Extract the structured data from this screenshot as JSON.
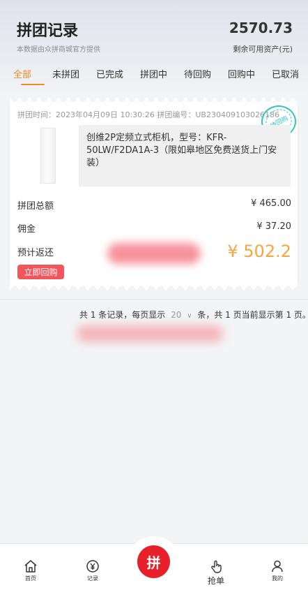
{
  "header": {
    "title": "拼团记录",
    "subtitle": "本数据由众拼商城官方提供",
    "balance_value": "2570.73",
    "balance_label": "剩余可用资产(元)"
  },
  "tabs": [
    {
      "label": "全部",
      "active": true
    },
    {
      "label": "未拼团"
    },
    {
      "label": "已完成"
    },
    {
      "label": "拼团中"
    },
    {
      "label": "待回购"
    },
    {
      "label": "回购中"
    },
    {
      "label": "已取消"
    }
  ],
  "order": {
    "meta": "拼团时间：2023年04月09日 10:30:26 拼团编号：UB230409103026186",
    "stamp_text": "待回购",
    "product_name": "创维2P定频立式柜机，型号：KFR-50LW/F2DA1A-3（限如皋地区免费送货上门安装）",
    "rows": [
      {
        "label": "拼团总额",
        "value": "¥ 465.00"
      },
      {
        "label": "佣金",
        "value": "¥ 37.20"
      }
    ],
    "rebate_label": "预计返还",
    "rebate_value": "¥ 502.2",
    "buyback_button": "立即回购"
  },
  "pager": {
    "prefix": "共 1 条记录，每页显示",
    "page_size": "20",
    "suffix": "条，共 1 页当前显示第 1 页。"
  },
  "tabbar": {
    "items": [
      {
        "label": "首页",
        "icon": "home-icon"
      },
      {
        "label": "记录",
        "icon": "record-icon"
      },
      {
        "label": "拼",
        "icon": "group-buy-icon"
      },
      {
        "label": "抢单",
        "icon": "tap-icon"
      },
      {
        "label": "我的",
        "icon": "user-icon"
      }
    ]
  },
  "colors": {
    "accent": "#f08c22",
    "rebate": "#f5a641",
    "button_red": "#f0565c",
    "center_red": "#e8202a",
    "stamp": "#2fc5c5"
  }
}
